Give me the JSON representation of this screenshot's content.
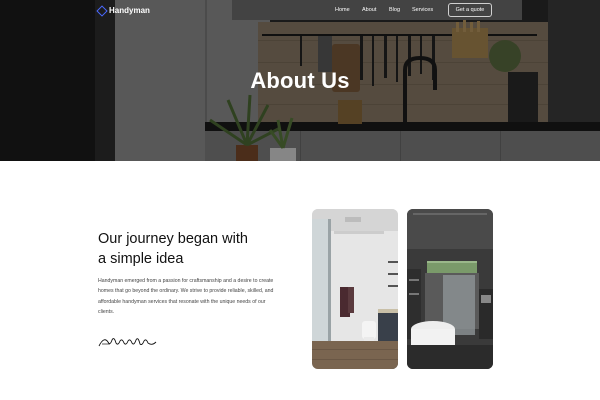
{
  "nav": {
    "logo_text": "Handyman",
    "links": [
      "Home",
      "About",
      "Blog",
      "Services"
    ],
    "cta_label": "Get a quote"
  },
  "hero": {
    "title": "About Us"
  },
  "about": {
    "heading_line1": "Our journey began with",
    "heading_line2": "a simple idea",
    "paragraph": "Handyman emerged from a passion for craftsmanship and a desire to create homes that go beyond the ordinary. We strive to provide reliable, skilled, and affordable handyman services that resonate with the unique needs of our clients.",
    "signature": "Alexander"
  },
  "colors": {
    "accent": "#4a68ff",
    "text_dark": "#111111",
    "text_body": "#444444"
  },
  "icons": {
    "logo": "diamond-logo-icon"
  }
}
